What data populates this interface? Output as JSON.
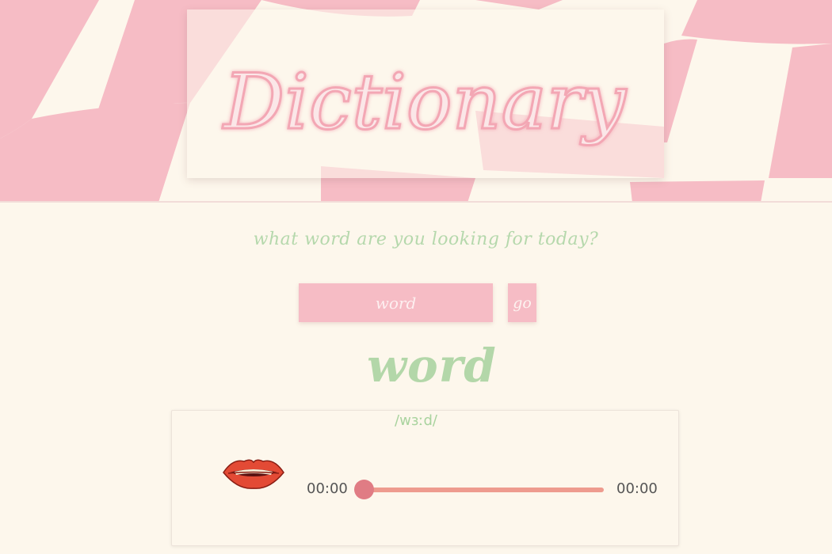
{
  "app": {
    "title": "Dictionary",
    "prompt": "what word are you looking for today?"
  },
  "search": {
    "placeholder": "word",
    "value": "",
    "button_label": "go"
  },
  "result": {
    "word": "word",
    "phonetic": "/wɜːd/"
  },
  "audio": {
    "current_time": "00:00",
    "total_time": "00:00",
    "progress": 0
  },
  "icons": {
    "pronunciation": "lips-icon"
  },
  "colors": {
    "background": "#fdf7ec",
    "checker_pink": "#f6bcc5",
    "title_pink": "#f3a7b4",
    "accent_green": "#b3d7a9",
    "slider": "#ee9b8e",
    "slider_thumb": "#e07c84"
  }
}
